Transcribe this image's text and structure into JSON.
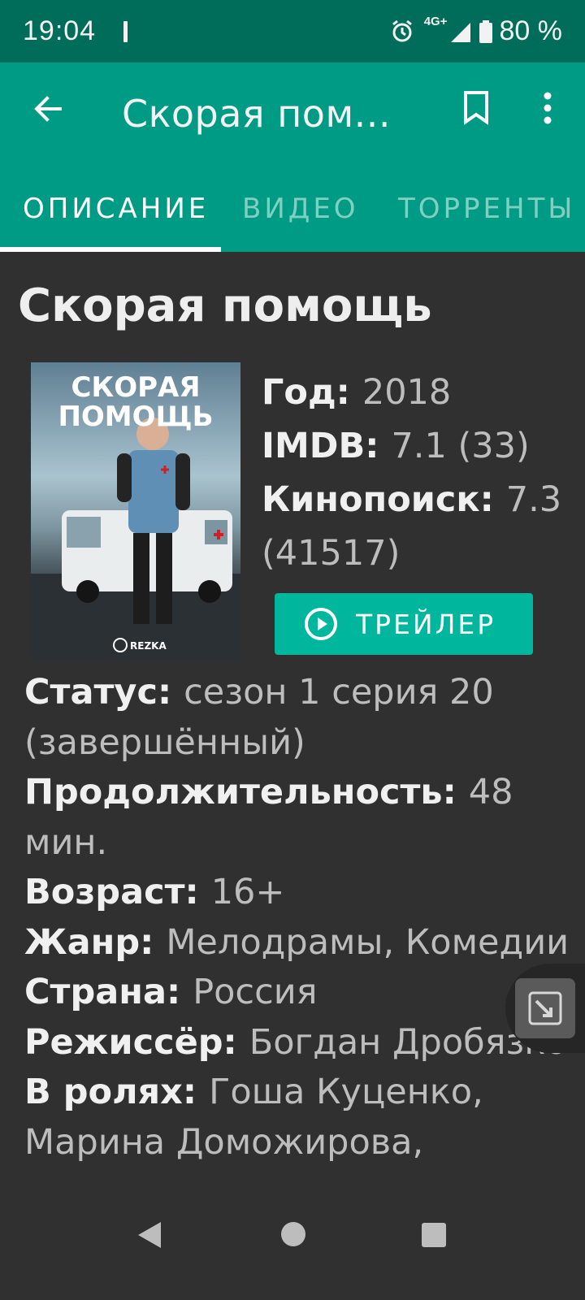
{
  "status_bar": {
    "time": "19:04",
    "network": "4G+",
    "battery": "80 %"
  },
  "app_bar": {
    "title": "Скорая пом..."
  },
  "tabs": [
    {
      "label": "ОПИСАНИЕ"
    },
    {
      "label": "ВИДЕО"
    },
    {
      "label": "ТОРРЕНТЫ"
    }
  ],
  "show": {
    "title": "Скорая помощь",
    "poster": {
      "title_line1": "СКОРАЯ",
      "title_line2": "ПОМОЩЬ",
      "watermark": "REZKA"
    },
    "year_label": "Год",
    "year": "2018",
    "imdb_label": "IMDB",
    "imdb": "7.1 (33)",
    "kp_label": "Кинопоиск",
    "kp": "7.3 (41517)",
    "trailer_button": "ТРЕЙЛЕР",
    "status_label": "Статус",
    "status": "сезон 1 серия 20 (завершённый)",
    "duration_label": "Продолжительность",
    "duration": "48 мин.",
    "age_label": "Возраст",
    "age": "16+",
    "genre_label": "Жанр",
    "genre": "Мелодрамы, Комедии",
    "country_label": "Страна",
    "country": "Россия",
    "director_label": "Режиссёр",
    "director": "Богдан Дробязко",
    "cast_label": "В ролях",
    "cast": "Гоша Куценко, Марина Доможирова,"
  },
  "colors": {
    "status_bar": "#006d5b",
    "app_bar": "#009b84",
    "accent": "#00b79d",
    "background": "#303030"
  }
}
